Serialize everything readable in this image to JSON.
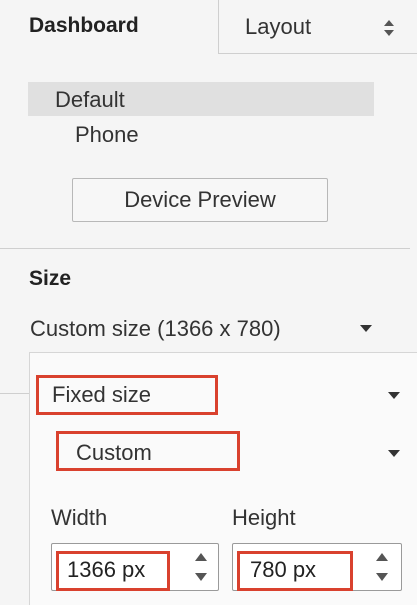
{
  "tabs": {
    "dashboard_label": "Dashboard",
    "layout_label": "Layout",
    "layout_icon": "up-down-chevron-icon"
  },
  "devices": {
    "items": [
      "Default",
      "Phone"
    ],
    "selected": "Default",
    "preview_button_label": "Device Preview"
  },
  "size": {
    "heading": "Size",
    "selected_option": "Custom size (1366 x 780)",
    "mode_value": "Fixed size",
    "preset_value": "Custom",
    "width_label": "Width",
    "height_label": "Height",
    "width_value": "1366 px",
    "height_value": "780 px"
  },
  "colors": {
    "highlight": "#d9412e",
    "selected_row": "#e0e0e0",
    "background": "#f5f5f5"
  }
}
